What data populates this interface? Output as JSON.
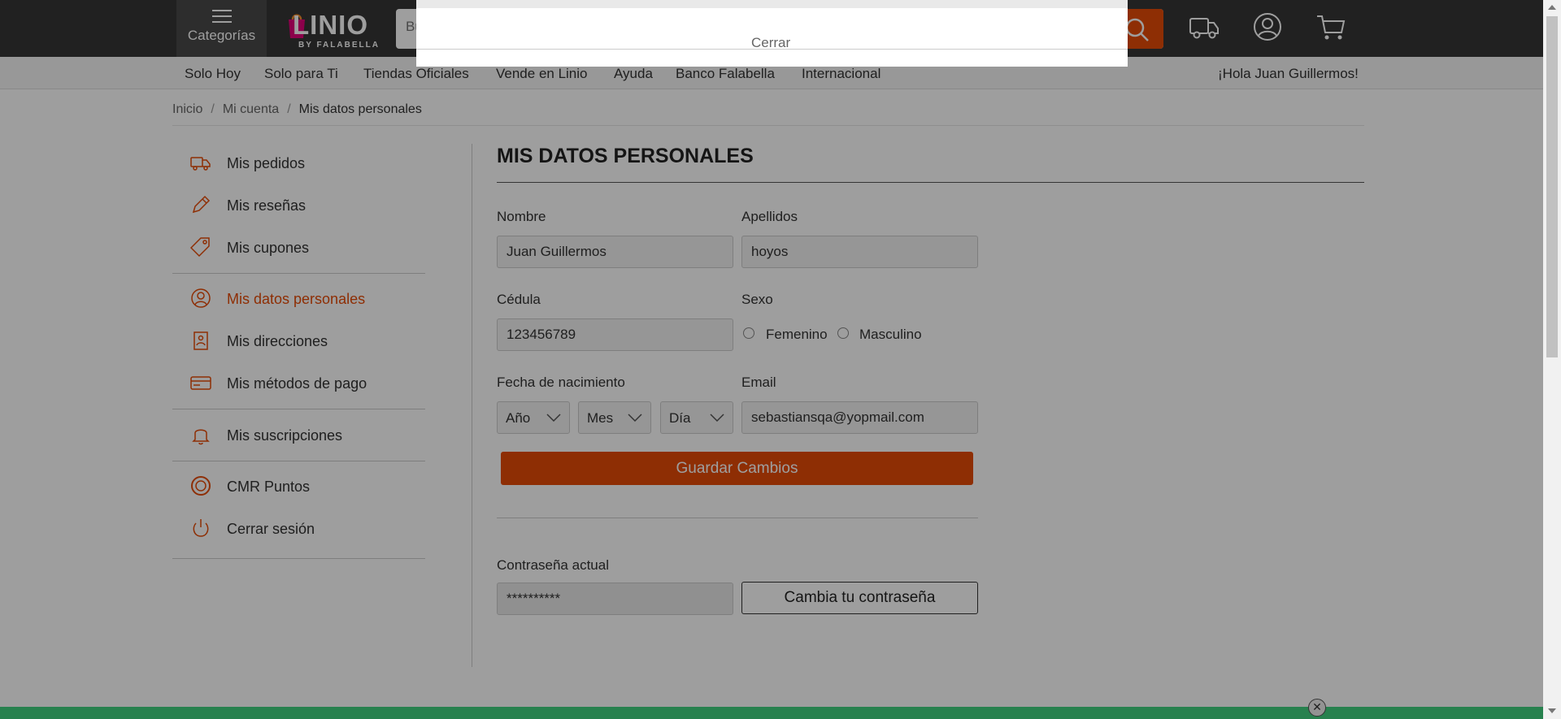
{
  "header": {
    "categories_label": "Categorías",
    "logo_text": "LINIO",
    "logo_sub": "BY FALABELLA",
    "search_placeholder": "Busca productos",
    "nav": [
      "Solo Hoy",
      "Solo para Ti",
      "Tiendas Oficiales",
      "Vende en Linio",
      "Ayuda",
      "Banco Falabella",
      "Internacional"
    ],
    "greeting": "¡Hola Juan Guillermos!"
  },
  "popup": {
    "close_label": "Cerrar"
  },
  "breadcrumb": {
    "home": "Inicio",
    "account": "Mi cuenta",
    "current": "Mis datos personales",
    "sep": "/"
  },
  "sidebar": {
    "items": [
      {
        "label": "Mis pedidos",
        "icon": "truck-icon"
      },
      {
        "label": "Mis reseñas",
        "icon": "pencil-icon"
      },
      {
        "label": "Mis cupones",
        "icon": "tag-icon"
      },
      {
        "label": "Mis datos personales",
        "icon": "user-icon"
      },
      {
        "label": "Mis direcciones",
        "icon": "building-icon"
      },
      {
        "label": "Mis métodos de pago",
        "icon": "card-icon"
      },
      {
        "label": "Mis suscripciones",
        "icon": "bell-icon"
      },
      {
        "label": "CMR Puntos",
        "icon": "cmr-icon"
      },
      {
        "label": "Cerrar sesión",
        "icon": "power-icon"
      }
    ]
  },
  "form": {
    "title": "MIS DATOS PERSONALES",
    "nombre_label": "Nombre",
    "nombre_value": "Juan Guillermos",
    "apellidos_label": "Apellidos",
    "apellidos_value": "hoyos",
    "cedula_label": "Cédula",
    "cedula_value": "123456789",
    "sexo_label": "Sexo",
    "sexo_options": [
      "Femenino",
      "Masculino"
    ],
    "fecha_label": "Fecha de nacimiento",
    "year_label": "Año",
    "month_label": "Mes",
    "day_label": "Día",
    "email_label": "Email",
    "email_value": "sebastiansqa@yopmail.com",
    "save_label": "Guardar Cambios",
    "password_label": "Contraseña actual",
    "password_value": "**********",
    "change_password_label": "Cambia tu contraseña"
  },
  "colors": {
    "accent": "#e54b08",
    "header": "#363636",
    "banner": "#3fd17f"
  }
}
